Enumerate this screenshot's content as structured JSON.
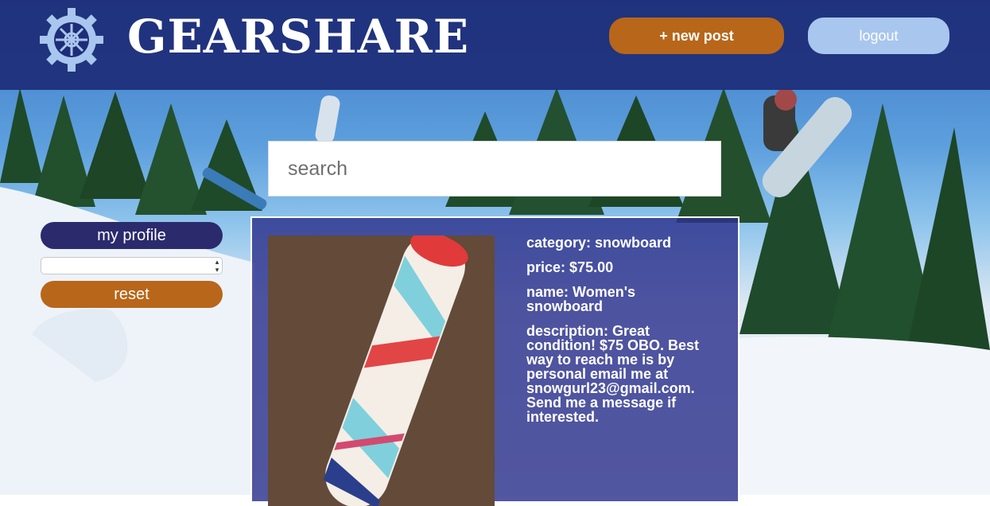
{
  "header": {
    "brand": "GEARSHARE",
    "new_post_label": "+ new post",
    "logout_label": "logout"
  },
  "search": {
    "placeholder": "search"
  },
  "sidebar": {
    "profile_label": "my profile",
    "filter_value": "",
    "reset_label": "reset"
  },
  "listing": {
    "category_label": "category:",
    "category": "snowboard",
    "price_label": "price:",
    "price": "$75.00",
    "name_label": "name:",
    "name": "Women's snowboard",
    "description_label": "description:",
    "description": "Great condition! $75 OBO. Best way to reach me is by personal email me at snowgurl23@gmail.com. Send me a message if interested."
  },
  "colors": {
    "header_bg": "#1e2d78",
    "accent_orange": "#b8661a",
    "logout_blue": "#a9c6ee",
    "profile_navy": "#2b2a6d",
    "card_bg": "#2d328c"
  },
  "icons": {
    "logo": "gear-icon"
  }
}
